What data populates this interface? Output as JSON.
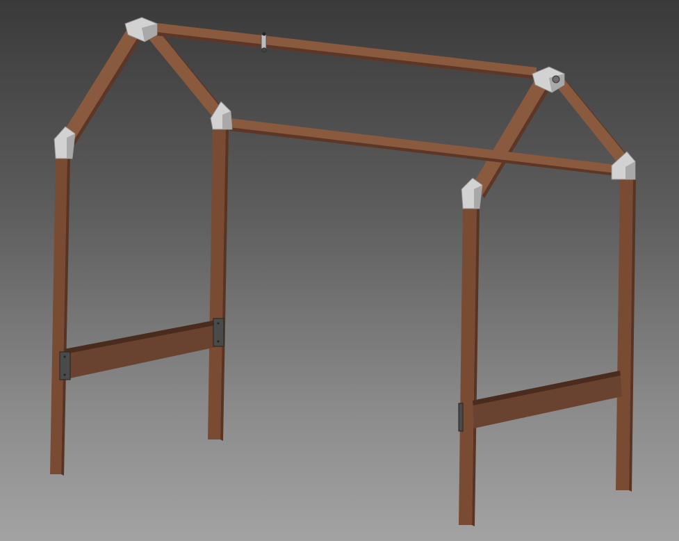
{
  "scene": {
    "background_top": "#3a3a3a",
    "background_bottom": "#a3a3a3",
    "wood_color": "#7a4b33",
    "bracket_color": "#d2d2d2",
    "plate_color": "#4a4a4a"
  }
}
